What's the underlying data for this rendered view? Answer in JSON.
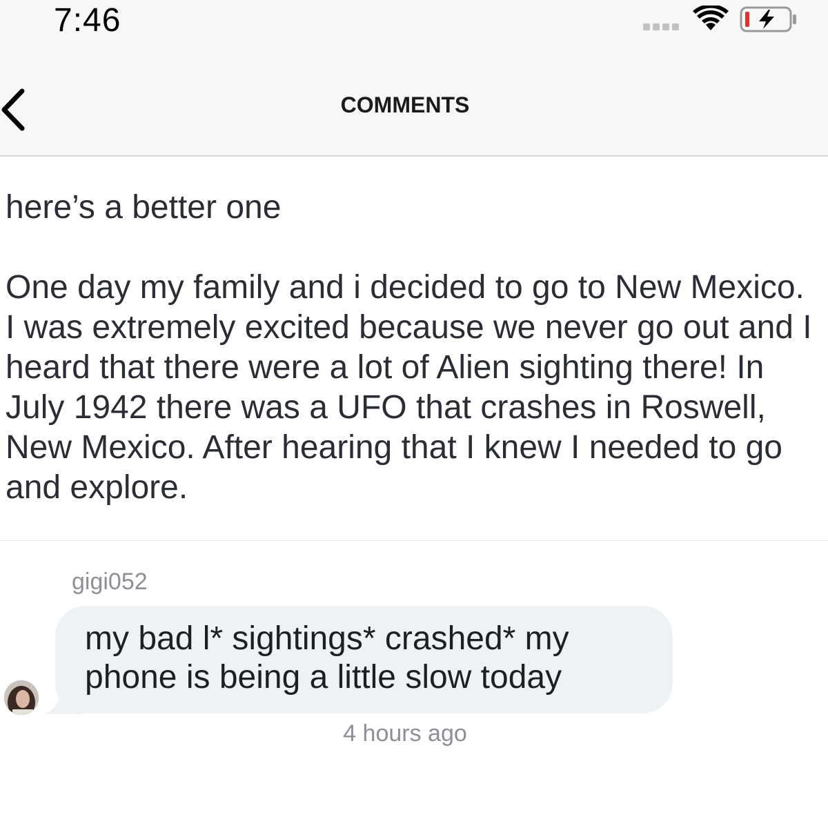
{
  "status_bar": {
    "time": "7:46"
  },
  "header": {
    "title": "COMMENTS",
    "back_icon": "chevron-left-icon"
  },
  "post": {
    "text": "here’s a better one\n\nOne day my family and i decided to go to New Mexico. I was extremely excited because we never go out and I heard that there were a lot of Alien sighting there! In July 1942 there was a UFO that crashes in Roswell, New Mexico. After hearing that I knew I needed to go and explore."
  },
  "comment": {
    "username": "gigi052",
    "text": "my bad l* sightings* crashed* my phone is being a little slow today",
    "timestamp": "4 hours ago"
  },
  "colors": {
    "header_bg": "#f7f7f6",
    "bubble_bg": "#eff2f4",
    "text": "#2b2d35",
    "muted": "#8d8f96",
    "battery_low": "#e0332f"
  }
}
